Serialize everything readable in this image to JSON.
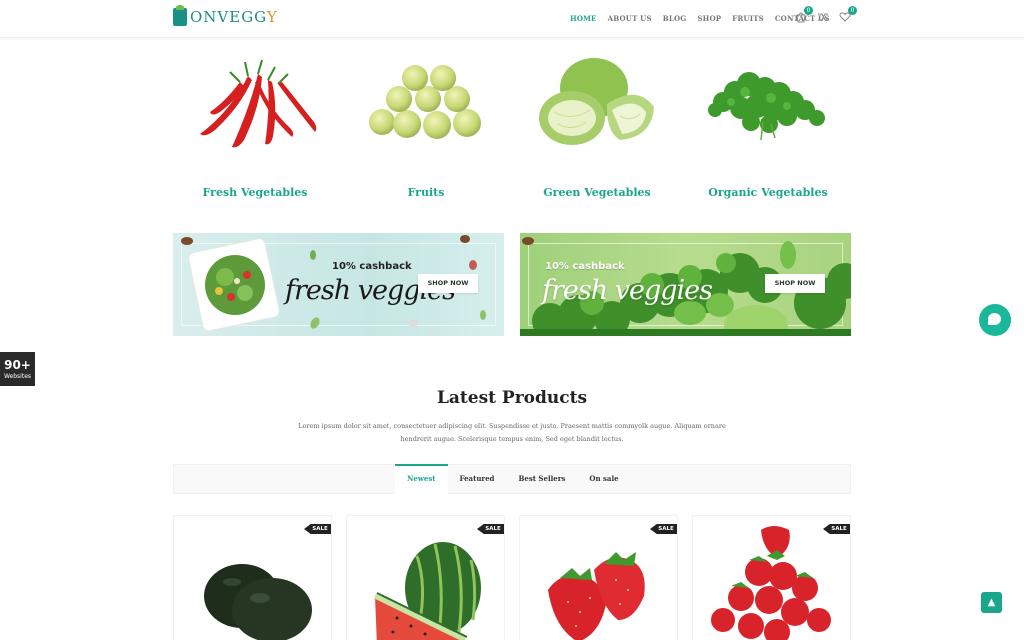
{
  "header": {
    "logo_text_main": "ONVEGG",
    "logo_text_end": "Y",
    "nav": [
      "HOME",
      "ABOUT US",
      "BLOG",
      "SHOP",
      "FRUITS",
      "CONTACT US"
    ],
    "cart_count": "0",
    "wishlist_count": "0"
  },
  "categories": [
    {
      "label": "Fresh Vegetables"
    },
    {
      "label": "Fruits"
    },
    {
      "label": "Green Vegetables"
    },
    {
      "label": "Organic Vegetables"
    }
  ],
  "banners": [
    {
      "cashback": "10% cashback",
      "script": "fresh veggies",
      "button": "SHOP NOW"
    },
    {
      "cashback": "10% cashback",
      "script": "fresh veggies",
      "button": "SHOP NOW"
    }
  ],
  "side": {
    "sites_num": "90+",
    "sites_label": "Websites"
  },
  "latest": {
    "title": "Latest Products",
    "desc_line1": "Lorem ipsum dolor sit amet, consectetuer adipiscing elit. Suspendisse et justo. Praesent mattis commyolk augue. Aliquam ornare",
    "desc_line2": "hendrerit augue. Scelerisque tempus enim, Sed eget blandit lectus."
  },
  "tabs": [
    "Newest",
    "Featured",
    "Best Sellers",
    "On sale"
  ],
  "products": [
    {
      "badge": "SALE"
    },
    {
      "badge": "SALE"
    },
    {
      "badge": "SALE"
    },
    {
      "badge": "SALE"
    }
  ],
  "colors": {
    "accent": "#1aa68c",
    "dark": "#222222"
  }
}
